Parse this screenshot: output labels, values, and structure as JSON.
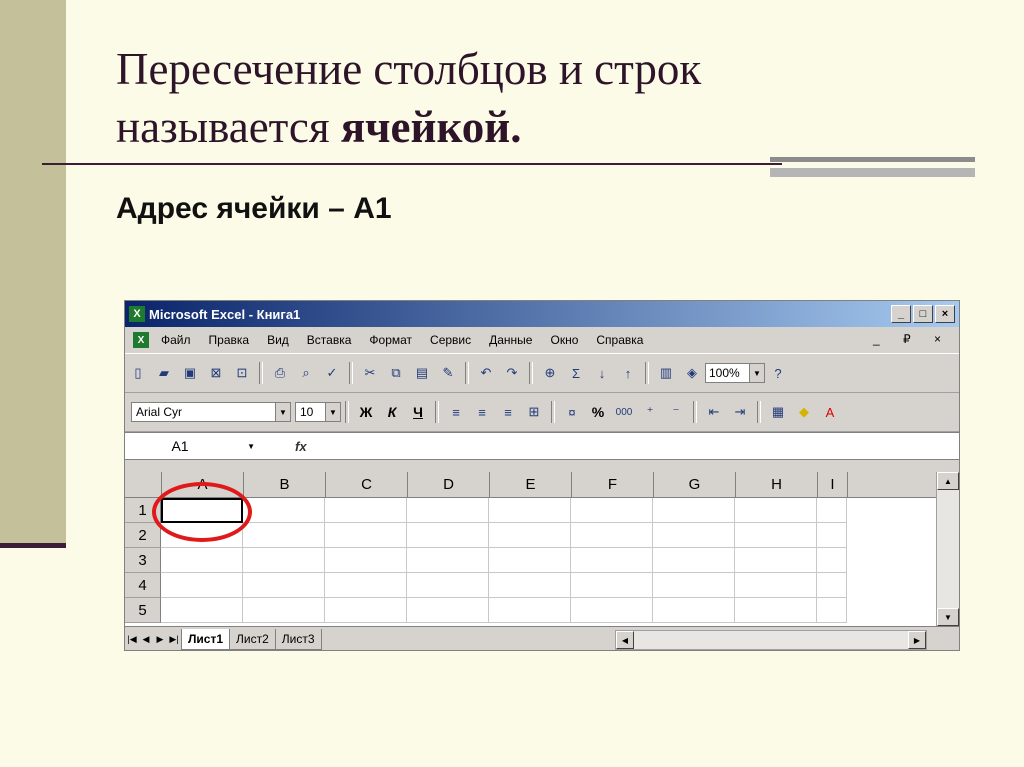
{
  "slide": {
    "title_line1": "Пересечение столбцов и строк",
    "title_line2_prefix": "называется ",
    "title_line2_bold": "ячейкой.",
    "address_label": "Адрес ячейки – А1"
  },
  "excel": {
    "window_title": "Microsoft Excel - Книга1",
    "window_buttons": [
      "_",
      "□",
      "×"
    ],
    "menu": [
      "Файл",
      "Правка",
      "Вид",
      "Вставка",
      "Формат",
      "Сервис",
      "Данные",
      "Окно",
      "Справка"
    ],
    "menu_right": "_ ₽ ×",
    "toolbar_icons": [
      "new-icon",
      "open-icon",
      "save-icon",
      "permission-icon",
      "print-preview-icon",
      "print-icon",
      "preview-icon",
      "spelling-icon",
      "cut-icon",
      "copy-icon",
      "paste-icon",
      "format-painter-icon",
      "undo-icon",
      "redo-icon",
      "hyperlink-icon",
      "autosum-icon",
      "sort-asc-icon",
      "sort-desc-icon",
      "chart-icon",
      "drawing-icon"
    ],
    "zoom": "100%",
    "help_label": "?",
    "font_name": "Arial Cyr",
    "font_size": "10",
    "format_buttons": [
      "Ж",
      "К",
      "Ч"
    ],
    "percent_label": "%",
    "thousands_label": "000",
    "namebox": "A1",
    "fx_label": "fx",
    "columns": [
      "A",
      "B",
      "C",
      "D",
      "E",
      "F",
      "G",
      "H",
      "I"
    ],
    "rows": [
      "1",
      "2",
      "3",
      "4",
      "5"
    ],
    "sheet_tabs": [
      "Лист1",
      "Лист2",
      "Лист3"
    ],
    "active_cell": "A1",
    "highlight_color": "#e01a1a"
  }
}
